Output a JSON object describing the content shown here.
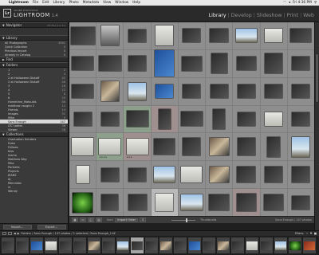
{
  "menubar": {
    "items": [
      "Lightroom",
      "File",
      "Edit",
      "Library",
      "Photo",
      "Metadata",
      "View",
      "Window",
      "Help"
    ],
    "clock": "Fri 4:36 PM"
  },
  "brand": {
    "adobe": "ADOBE PHOTOSHOP",
    "product": "LIGHTROOM",
    "version": "1.4",
    "logo": "Lr"
  },
  "modules": {
    "items": [
      "Library",
      "Develop",
      "Slideshow",
      "Print",
      "Web"
    ],
    "active": "Library"
  },
  "left_panel": {
    "navigator": {
      "title": "Navigator",
      "zoom": "FIT FILL 1:1 3:1"
    },
    "library": {
      "title": "Library",
      "items": [
        {
          "label": "All Photographs",
          "count": "4582"
        },
        {
          "label": "Quick Collection",
          "count": "0"
        },
        {
          "label": "Previous Import",
          "count": "8"
        },
        {
          "label": "Already In Catalog",
          "count": "8"
        }
      ]
    },
    "find": {
      "title": "Find"
    },
    "folders": {
      "title": "Folders",
      "items": [
        {
          "label": "1",
          "count": "2"
        },
        {
          "label": "2",
          "count": "4"
        },
        {
          "label": "2 at Halloween Diskoff",
          "count": "42"
        },
        {
          "label": "2 at Halloween Diskoff",
          "count": "46"
        },
        {
          "label": "3",
          "count": "18"
        },
        {
          "label": "4",
          "count": "12"
        },
        {
          "label": "5",
          "count": "8"
        },
        {
          "label": "6",
          "count": "20"
        },
        {
          "label": "Hometime_Matsubis",
          "count": "86"
        },
        {
          "label": "matthew vaughn 2",
          "count": "12"
        },
        {
          "label": "Friends",
          "count": "14"
        },
        {
          "label": "Images",
          "count": "32"
        },
        {
          "label": "Mike",
          "count": "9"
        },
        {
          "label": "Sans Enough",
          "count": "147",
          "selected": true
        },
        {
          "label": "LTC Ladies",
          "count": "36"
        },
        {
          "label": "Viewer",
          "count": "28"
        }
      ]
    },
    "collections": {
      "title": "Collections",
      "items": [
        {
          "label": "Graduation Henders",
          "count": ""
        },
        {
          "label": "Duke",
          "count": ""
        },
        {
          "label": "Fellows",
          "count": ""
        },
        {
          "label": "Kids",
          "count": ""
        },
        {
          "label": "Inamo",
          "count": ""
        },
        {
          "label": "Matthew Wey",
          "count": ""
        },
        {
          "label": "Misc",
          "count": ""
        },
        {
          "label": "Portraits",
          "count": ""
        },
        {
          "label": "Projects",
          "count": ""
        },
        {
          "label": "JEANS",
          "count": ""
        },
        {
          "label": "AJ",
          "count": ""
        },
        {
          "label": "Mercados",
          "count": ""
        },
        {
          "label": "rs",
          "count": ""
        },
        {
          "label": "Wendy",
          "count": ""
        }
      ]
    },
    "buttons": {
      "import": "Import...",
      "export": "Export..."
    }
  },
  "grid": {
    "columns": 9,
    "rows": 7,
    "cells": [
      {
        "bg": "n",
        "t": "dark",
        "w": 0.55,
        "h": 0.4
      },
      {
        "bg": "n",
        "t": "street",
        "w": 0.4,
        "h": 0.45
      },
      {
        "bg": "n",
        "t": "dark",
        "w": 0.4,
        "h": 0.28
      },
      {
        "bg": "n",
        "t": "wall",
        "w": 0.4,
        "h": 0.45
      },
      {
        "bg": "n",
        "t": "dark",
        "w": 0.4,
        "h": 0.3
      },
      {
        "bg": "n",
        "t": "dark",
        "w": 0.42,
        "h": 0.3
      },
      {
        "bg": "n",
        "t": "sky",
        "w": 0.48,
        "h": 0.3
      },
      {
        "bg": "n",
        "t": "wall",
        "w": 0.4,
        "h": 0.3
      },
      {
        "bg": "n",
        "t": "dark",
        "w": 0.48,
        "h": 0.3
      },
      {
        "bg": "n",
        "t": "dark",
        "w": 0.5,
        "h": 0.3
      },
      {
        "bg": "n",
        "t": "dark",
        "w": 0.52,
        "h": 0.34
      },
      {
        "bg": "n",
        "t": "dark",
        "w": 0.4,
        "h": 0.34
      },
      {
        "bg": "n",
        "t": "blue",
        "w": 0.44,
        "h": 0.6
      },
      {
        "bg": "n",
        "t": "dark",
        "w": 0.45,
        "h": 0.32
      },
      {
        "bg": "n",
        "t": "dark",
        "w": 0.36,
        "h": 0.45
      },
      {
        "bg": "n",
        "t": "dark",
        "w": 0.44,
        "h": 0.3
      },
      {
        "bg": "n",
        "t": "dark",
        "w": 0.4,
        "h": 0.45
      },
      {
        "bg": "n",
        "t": "dark",
        "w": 0.4,
        "h": 0.3
      },
      {
        "bg": "n",
        "t": "dark",
        "w": 0.5,
        "h": 0.3
      },
      {
        "bg": "n",
        "t": "mixed",
        "w": 0.4,
        "h": 0.45
      },
      {
        "bg": "n",
        "t": "sky",
        "w": 0.4,
        "h": 0.4
      },
      {
        "bg": "n",
        "t": "blue",
        "w": 0.4,
        "h": 0.3
      },
      {
        "bg": "n",
        "t": "dark",
        "w": 0.4,
        "h": 0.3
      },
      {
        "bg": "n",
        "t": "dark",
        "w": 0.4,
        "h": 0.3
      },
      {
        "bg": "n",
        "t": "dark",
        "w": 0.4,
        "h": 0.3
      },
      {
        "bg": "n",
        "t": "dark",
        "w": 0.4,
        "h": 0.3
      },
      {
        "bg": "n",
        "t": "dark",
        "w": 0.4,
        "h": 0.3
      },
      {
        "bg": "n",
        "t": "dark",
        "w": 0.4,
        "h": 0.3
      },
      {
        "bg": "n",
        "t": "dark",
        "w": 0.4,
        "h": 0.3
      },
      {
        "bg": "g",
        "t": "dark",
        "w": 0.5,
        "h": 0.36
      },
      {
        "bg": "r",
        "t": "dark",
        "w": 0.28,
        "h": 0.45
      },
      {
        "bg": "n",
        "t": "dark",
        "w": 0.5,
        "h": 0.32
      },
      {
        "bg": "n",
        "t": "dark",
        "w": 0.28,
        "h": 0.45
      },
      {
        "bg": "n",
        "t": "dark",
        "w": 0.4,
        "h": 0.3
      },
      {
        "bg": "n",
        "t": "wall",
        "w": 0.4,
        "h": 0.3
      },
      {
        "bg": "n",
        "t": "dark",
        "w": 0.4,
        "h": 0.3
      },
      {
        "bg": "n",
        "t": "wall",
        "w": 0.5,
        "h": 0.4
      },
      {
        "bg": "g",
        "t": "wall",
        "w": 0.5,
        "h": 0.36,
        "stars": "★★★★"
      },
      {
        "bg": "r",
        "t": "wall",
        "w": 0.5,
        "h": 0.36,
        "stars": "★★★"
      },
      {
        "bg": "n",
        "t": "dark",
        "w": 0.48,
        "h": 0.36
      },
      {
        "bg": "n",
        "t": "dark",
        "w": 0.4,
        "h": 0.4
      },
      {
        "bg": "n",
        "t": "mixed",
        "w": 0.44,
        "h": 0.4
      },
      {
        "bg": "n",
        "t": "dark",
        "w": 0.4,
        "h": 0.4
      },
      {
        "bg": "n",
        "t": "dark",
        "w": 0.3,
        "h": 0.45
      },
      {
        "bg": "n",
        "t": "sky",
        "w": 0.4,
        "h": 0.45
      },
      {
        "bg": "n",
        "t": "wall",
        "w": 0.3,
        "h": 0.4
      },
      {
        "bg": "n",
        "t": "dark",
        "w": 0.4,
        "h": 0.3
      },
      {
        "bg": "n",
        "t": "dark",
        "w": 0.4,
        "h": 0.3
      },
      {
        "bg": "n",
        "t": "sky",
        "w": 0.48,
        "h": 0.36
      },
      {
        "bg": "n",
        "t": "wall",
        "w": 0.48,
        "h": 0.36
      },
      {
        "bg": "n",
        "t": "mixed",
        "w": 0.44,
        "h": 0.36
      },
      {
        "bg": "n",
        "t": "dark",
        "w": 0.42,
        "h": 0.36
      },
      {
        "bg": "n",
        "t": "dark",
        "w": 0.4,
        "h": 0.36
      },
      {
        "bg": "n",
        "t": "dark",
        "w": 0.4,
        "h": 0.36
      },
      {
        "bg": "n",
        "t": "green",
        "w": 0.45,
        "h": 0.45
      },
      {
        "bg": "n",
        "t": "dark",
        "w": 0.38,
        "h": 0.36
      },
      {
        "bg": "n",
        "t": "dark",
        "w": 0.42,
        "h": 0.36
      },
      {
        "bg": "sel",
        "t": "wall",
        "w": 0.4,
        "h": 0.4
      },
      {
        "bg": "n",
        "t": "sky",
        "w": 0.5,
        "h": 0.36
      },
      {
        "bg": "n",
        "t": "dark",
        "w": 0.45,
        "h": 0.36
      },
      {
        "bg": "r",
        "t": "dark",
        "w": 0.44,
        "h": 0.4
      },
      {
        "bg": "n",
        "t": "dark",
        "w": 0.44,
        "h": 0.36
      },
      {
        "bg": "n",
        "t": "dark",
        "w": 0.4,
        "h": 0.3
      }
    ]
  },
  "toolbar": {
    "sort_label": "Sort:",
    "sort_value": "Import Order",
    "filter_label": "Thumbnails",
    "info": "Sans Enough / 147 photos"
  },
  "filmbar": {
    "path": "Folders / Sans Enough / 147 photos / 1 selected / Sans Enough_1.tif",
    "filter_label": "Filters:"
  },
  "filmstrip": {
    "items": [
      {
        "t": "dark"
      },
      {
        "t": "dark"
      },
      {
        "t": "blue"
      },
      {
        "t": "wall"
      },
      {
        "t": "dark"
      },
      {
        "t": "dark"
      },
      {
        "t": "mixed"
      },
      {
        "t": "dark"
      },
      {
        "t": "sky"
      },
      {
        "t": "dark",
        "sel": true
      },
      {
        "t": "dark"
      },
      {
        "t": "mixed"
      },
      {
        "t": "dark"
      },
      {
        "t": "blue"
      },
      {
        "t": "dark"
      },
      {
        "t": "mixed"
      },
      {
        "t": "dark"
      },
      {
        "t": "wall"
      },
      {
        "t": "dark"
      },
      {
        "t": "sky"
      },
      {
        "t": "green"
      },
      {
        "t": "red"
      }
    ]
  },
  "colors": {
    "panel": "#3a3a3a",
    "grid": "#8e8e8e",
    "selected_row": "#d9d9d9",
    "green_label": "#8da08b",
    "red_label": "#9f8f8f"
  }
}
